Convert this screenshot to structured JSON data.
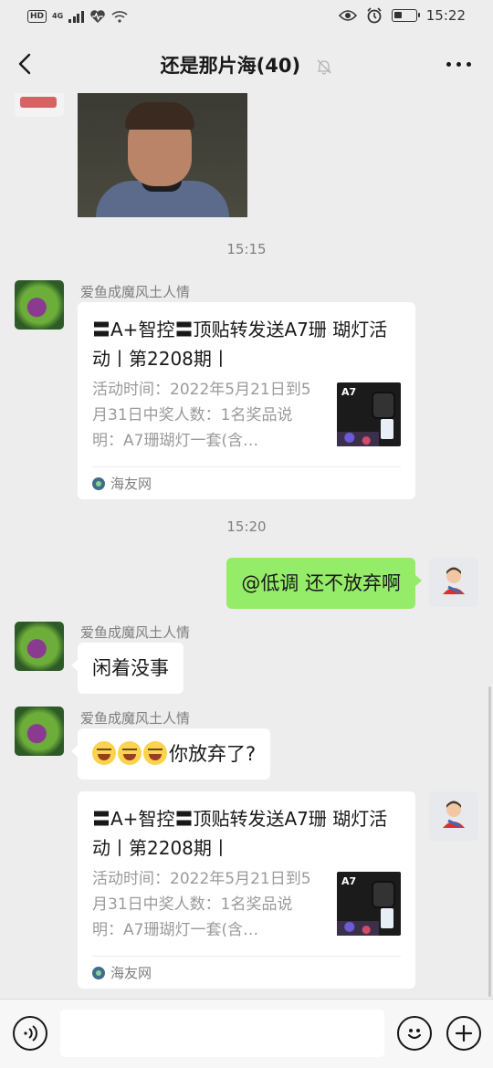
{
  "status_bar": {
    "hd": "HD",
    "network": "4G",
    "time": "15:22"
  },
  "nav": {
    "title": "还是那片海(40)",
    "icons": [
      "back-chevron-icon",
      "mute-bell-icon",
      "more-dots-icon"
    ]
  },
  "messages": [
    {
      "type": "image",
      "from": "other",
      "description_icon": "photo-thumbnail"
    },
    {
      "type": "time",
      "text": "15:15"
    },
    {
      "type": "link_card",
      "from": "other",
      "sender": "爱鱼成魔风土人情",
      "title": "〓A+智控〓顶贴转发送A7珊 瑚灯活动丨第2208期丨",
      "desc": "活动时间：2022年5月21日到5月31日中奖人数：1名奖品说明：A7珊瑚灯一套(含…",
      "thumb_label": "A7",
      "source": "海友网"
    },
    {
      "type": "time",
      "text": "15:20"
    },
    {
      "type": "text",
      "from": "me",
      "text": "@低调  还不放弃啊"
    },
    {
      "type": "text",
      "from": "other",
      "sender": "爱鱼成魔风土人情",
      "text": "闲着没事"
    },
    {
      "type": "text",
      "from": "other",
      "sender": "爱鱼成魔风土人情",
      "text": "你放弃了?",
      "emoji_count": 3
    },
    {
      "type": "link_card",
      "from": "me",
      "title": "〓A+智控〓顶贴转发送A7珊 瑚灯活动丨第2208期丨",
      "desc": "活动时间：2022年5月21日到5月31日中奖人数：1名奖品说明：A7珊瑚灯一套(含…",
      "thumb_label": "A7",
      "source": "海友网"
    }
  ],
  "input_bar": {
    "icons": [
      "voice-icon",
      "emoji-icon",
      "add-icon"
    ],
    "placeholder": ""
  },
  "colors": {
    "background": "#ededed",
    "my_bubble": "#95ec69",
    "other_bubble": "#ffffff",
    "meta_text": "#7f7f7f"
  }
}
